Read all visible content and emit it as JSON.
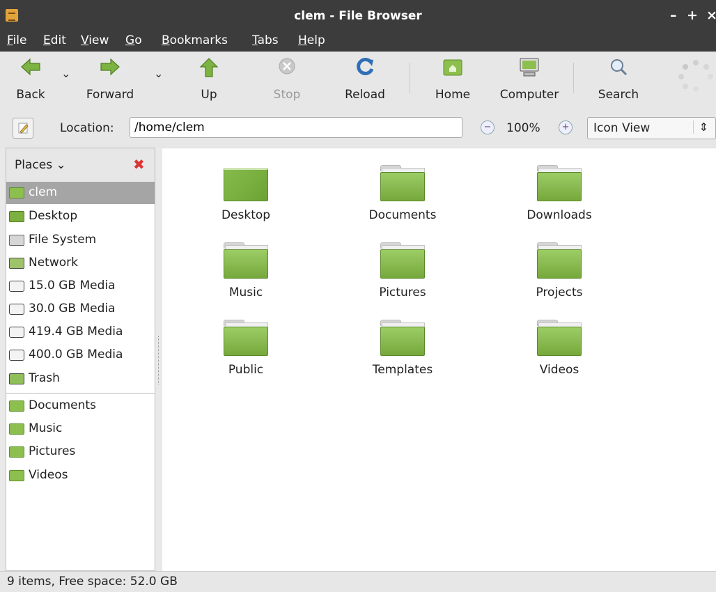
{
  "window": {
    "title": "clem - File Browser",
    "minimize": "–",
    "maximize": "+",
    "close": "×"
  },
  "menu": [
    {
      "label": "File",
      "mnemonic": "F",
      "rest": "ile"
    },
    {
      "label": "Edit",
      "mnemonic": "E",
      "rest": "dit"
    },
    {
      "label": "View",
      "mnemonic": "V",
      "rest": "iew"
    },
    {
      "label": "Go",
      "mnemonic": "G",
      "rest": "o"
    },
    {
      "label": "Bookmarks",
      "mnemonic": "B",
      "rest": "ookmarks"
    },
    {
      "label": "Tabs",
      "mnemonic": "T",
      "rest": "abs"
    },
    {
      "label": "Help",
      "mnemonic": "H",
      "rest": "elp"
    }
  ],
  "toolbar": {
    "back": "Back",
    "forward": "Forward",
    "up": "Up",
    "stop": "Stop",
    "reload": "Reload",
    "home": "Home",
    "computer": "Computer",
    "search": "Search",
    "dropdown": "⌄"
  },
  "location": {
    "label": "Location:",
    "value": "/home/clem",
    "zoom": "100%",
    "view_mode": "Icon View",
    "view_arrows": "⇕"
  },
  "sidebar": {
    "header": "Places",
    "header_chevron": "⌄",
    "close": "✖",
    "places": [
      {
        "label": "clem",
        "icon": "home-folder-icon",
        "selected": true
      },
      {
        "label": "Desktop",
        "icon": "desktop-icon"
      },
      {
        "label": "File System",
        "icon": "filesystem-icon"
      },
      {
        "label": "Network",
        "icon": "network-icon"
      },
      {
        "label": "15.0 GB Media",
        "icon": "drive-icon"
      },
      {
        "label": "30.0 GB Media",
        "icon": "drive-icon"
      },
      {
        "label": "419.4 GB Media",
        "icon": "drive-icon"
      },
      {
        "label": "400.0 GB Media",
        "icon": "drive-icon"
      },
      {
        "label": "Trash",
        "icon": "trash-icon"
      }
    ],
    "bookmarks": [
      {
        "label": "Documents",
        "icon": "folder-icon"
      },
      {
        "label": "Music",
        "icon": "folder-icon"
      },
      {
        "label": "Pictures",
        "icon": "folder-icon"
      },
      {
        "label": "Videos",
        "icon": "folder-icon"
      }
    ]
  },
  "files": [
    {
      "name": "Desktop",
      "icon": "desktop-folder-icon"
    },
    {
      "name": "Documents",
      "icon": "folder-icon"
    },
    {
      "name": "Downloads",
      "icon": "folder-icon"
    },
    {
      "name": "Music",
      "icon": "folder-icon"
    },
    {
      "name": "Pictures",
      "icon": "folder-icon"
    },
    {
      "name": "Projects",
      "icon": "folder-icon"
    },
    {
      "name": "Public",
      "icon": "folder-icon"
    },
    {
      "name": "Templates",
      "icon": "folder-icon"
    },
    {
      "name": "Videos",
      "icon": "folder-icon"
    }
  ],
  "status": {
    "text": "9 items, Free space: 52.0 GB"
  },
  "colors": {
    "titlebar": "#3c3c3c",
    "folder_green": "#8cbf4d",
    "selected_bg": "#a5a5a5"
  }
}
